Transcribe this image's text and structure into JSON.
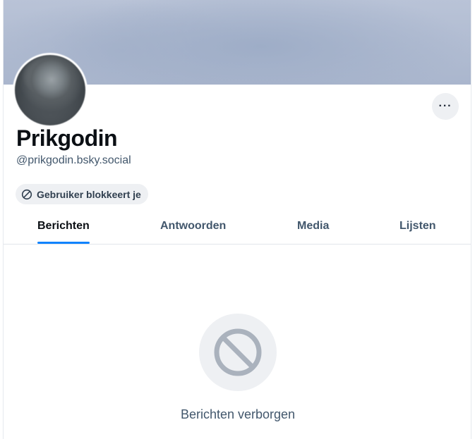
{
  "profile": {
    "display_name": "Prikgodin",
    "handle": "@prikgodin.bsky.social",
    "blocked_label": "Gebruiker blokkeert je"
  },
  "actions": {
    "more_label": "···"
  },
  "tabs": [
    {
      "label": "Berichten",
      "active": true
    },
    {
      "label": "Antwoorden",
      "active": false
    },
    {
      "label": "Media",
      "active": false
    },
    {
      "label": "Lijsten",
      "active": false
    }
  ],
  "empty_state": {
    "icon": "block-icon",
    "text": "Berichten verborgen"
  },
  "colors": {
    "accent": "#1083fe",
    "muted_text": "#42576c",
    "icon_gray": "#aab2bd"
  }
}
